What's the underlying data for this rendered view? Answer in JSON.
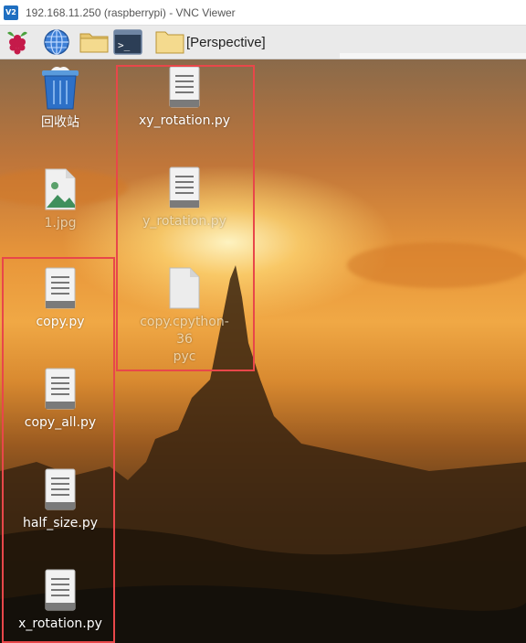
{
  "window": {
    "logo_text": "V2",
    "title": "192.168.11.250 (raspberrypi) - VNC Viewer"
  },
  "taskbar": {
    "items": [
      {
        "name": "raspberry-menu-icon"
      },
      {
        "name": "web-browser-icon"
      },
      {
        "name": "file-manager-icon"
      },
      {
        "name": "terminal-icon",
        "glyph": ">_"
      },
      {
        "name": "folder-icon"
      }
    ],
    "window_button_label": "[Perspective]"
  },
  "desktop": {
    "trash": {
      "label": "回收站"
    },
    "image_file": {
      "label": "1.jpg"
    },
    "files_left": [
      {
        "label": "copy.py"
      },
      {
        "label": "copy_all.py"
      },
      {
        "label": "half_size.py"
      },
      {
        "label": "x_rotation.py"
      }
    ],
    "files_mid": [
      {
        "label": "xy_rotation.py"
      },
      {
        "label": "y_rotation.py"
      },
      {
        "label_line1": "copy.cpython-36",
        "label_line2": "pyc"
      }
    ],
    "highlight_color": "#e8474a"
  }
}
